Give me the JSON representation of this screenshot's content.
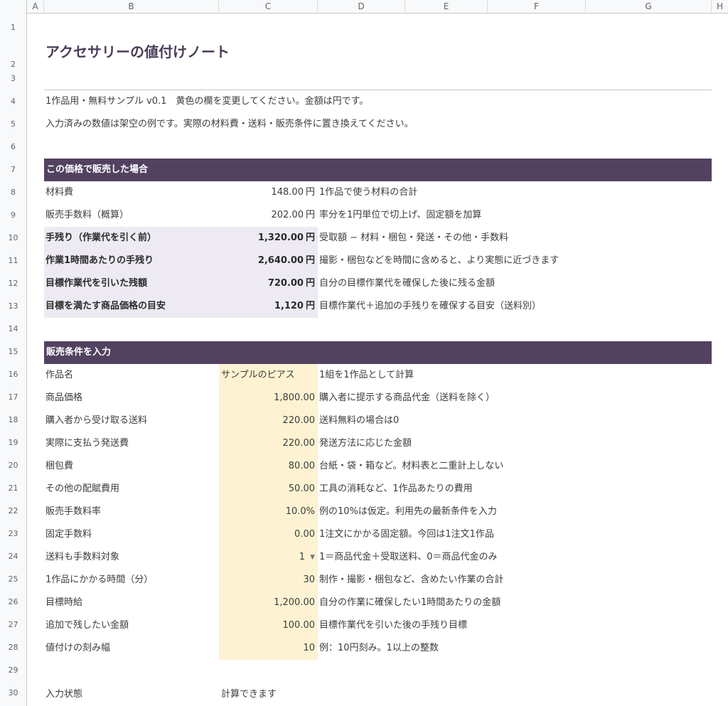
{
  "columns": [
    "A",
    "B",
    "C",
    "D",
    "E",
    "F",
    "G",
    "H"
  ],
  "rows": [
    "1",
    "2",
    "3",
    "4",
    "5",
    "6",
    "7",
    "8",
    "9",
    "10",
    "11",
    "12",
    "13",
    "14",
    "15",
    "16",
    "17",
    "18",
    "19",
    "20",
    "21",
    "22",
    "23",
    "24",
    "25",
    "26",
    "27",
    "28",
    "29",
    "30"
  ],
  "title": "アクセサリーの値付けノート",
  "intro": {
    "line1": "1作品用・無料サンプル v0.1　黄色の欄を変更してください。金額は円です。",
    "line2": "入力済みの数値は架空の例です。実際の材料費・送料・販売条件に置き換えてください。"
  },
  "colors": {
    "band": "#524260",
    "highlight": "#eeeaf3",
    "input": "#fdf3d2",
    "title": "#4a3d58"
  },
  "results": {
    "header": "この価格で販売した場合",
    "unit": "円",
    "rows": [
      {
        "label": "材料費",
        "value": "148.00",
        "unit": "円",
        "note": "1作品で使う材料の合計"
      },
      {
        "label": "販売手数料（概算）",
        "value": "202.00",
        "unit": "円",
        "note": "率分を1円単位で切上げ、固定額を加算"
      },
      {
        "label": "手残り（作業代を引く前）",
        "value": "1,320.00",
        "unit": "円",
        "note": "受取額 − 材料・梱包・発送・その他・手数料"
      },
      {
        "label": "作業1時間あたりの手残り",
        "value": "2,640.00",
        "unit": "円",
        "note": "撮影・梱包などを時間に含めると、より実態に近づきます"
      },
      {
        "label": "目標作業代を引いた残額",
        "value": "720.00",
        "unit": "円",
        "note": "自分の目標作業代を確保した後に残る金額"
      },
      {
        "label": "目標を満たす商品価格の目安",
        "value": "1,120",
        "unit": "円",
        "note": "目標作業代＋追加の手残りを確保する目安（送料別）"
      }
    ]
  },
  "inputs": {
    "header": "販売条件を入力",
    "rows": [
      {
        "label": "作品名",
        "value": "サンプルのピアス",
        "note": "1組を1作品として計算"
      },
      {
        "label": "商品価格",
        "value": "1,800.00",
        "note": "購入者に提示する商品代金（送料を除く）"
      },
      {
        "label": "購入者から受け取る送料",
        "value": "220.00",
        "note": "送料無料の場合は0"
      },
      {
        "label": "実際に支払う発送費",
        "value": "220.00",
        "note": "発送方法に応じた金額"
      },
      {
        "label": "梱包費",
        "value": "80.00",
        "note": "台紙・袋・箱など。材料表と二重計上しない"
      },
      {
        "label": "その他の配賦費用",
        "value": "50.00",
        "note": "工具の消耗など、1作品あたりの費用"
      },
      {
        "label": "販売手数料率",
        "value": "10.0%",
        "note": "例の10%は仮定。利用先の最新条件を入力"
      },
      {
        "label": "固定手数料",
        "value": "0.00",
        "note": "1注文にかかる固定額。今回は1注文1作品"
      },
      {
        "label": "送料も手数料対象",
        "value": "1",
        "caret": "▼",
        "note": "1＝商品代金＋受取送料、0＝商品代金のみ"
      },
      {
        "label": "1作品にかかる時間（分）",
        "value": "30",
        "note": "制作・撮影・梱包など、含めたい作業の合計"
      },
      {
        "label": "目標時給",
        "value": "1,200.00",
        "note": "自分の作業に確保したい1時間あたりの金額"
      },
      {
        "label": "追加で残したい金額",
        "value": "100.00",
        "note": "目標作業代を引いた後の手残り目標"
      },
      {
        "label": "値付けの刻み幅",
        "value": "10",
        "note": "例：10円刻み。1以上の整数"
      }
    ]
  },
  "status": {
    "label": "入力状態",
    "value": "計算できます"
  }
}
